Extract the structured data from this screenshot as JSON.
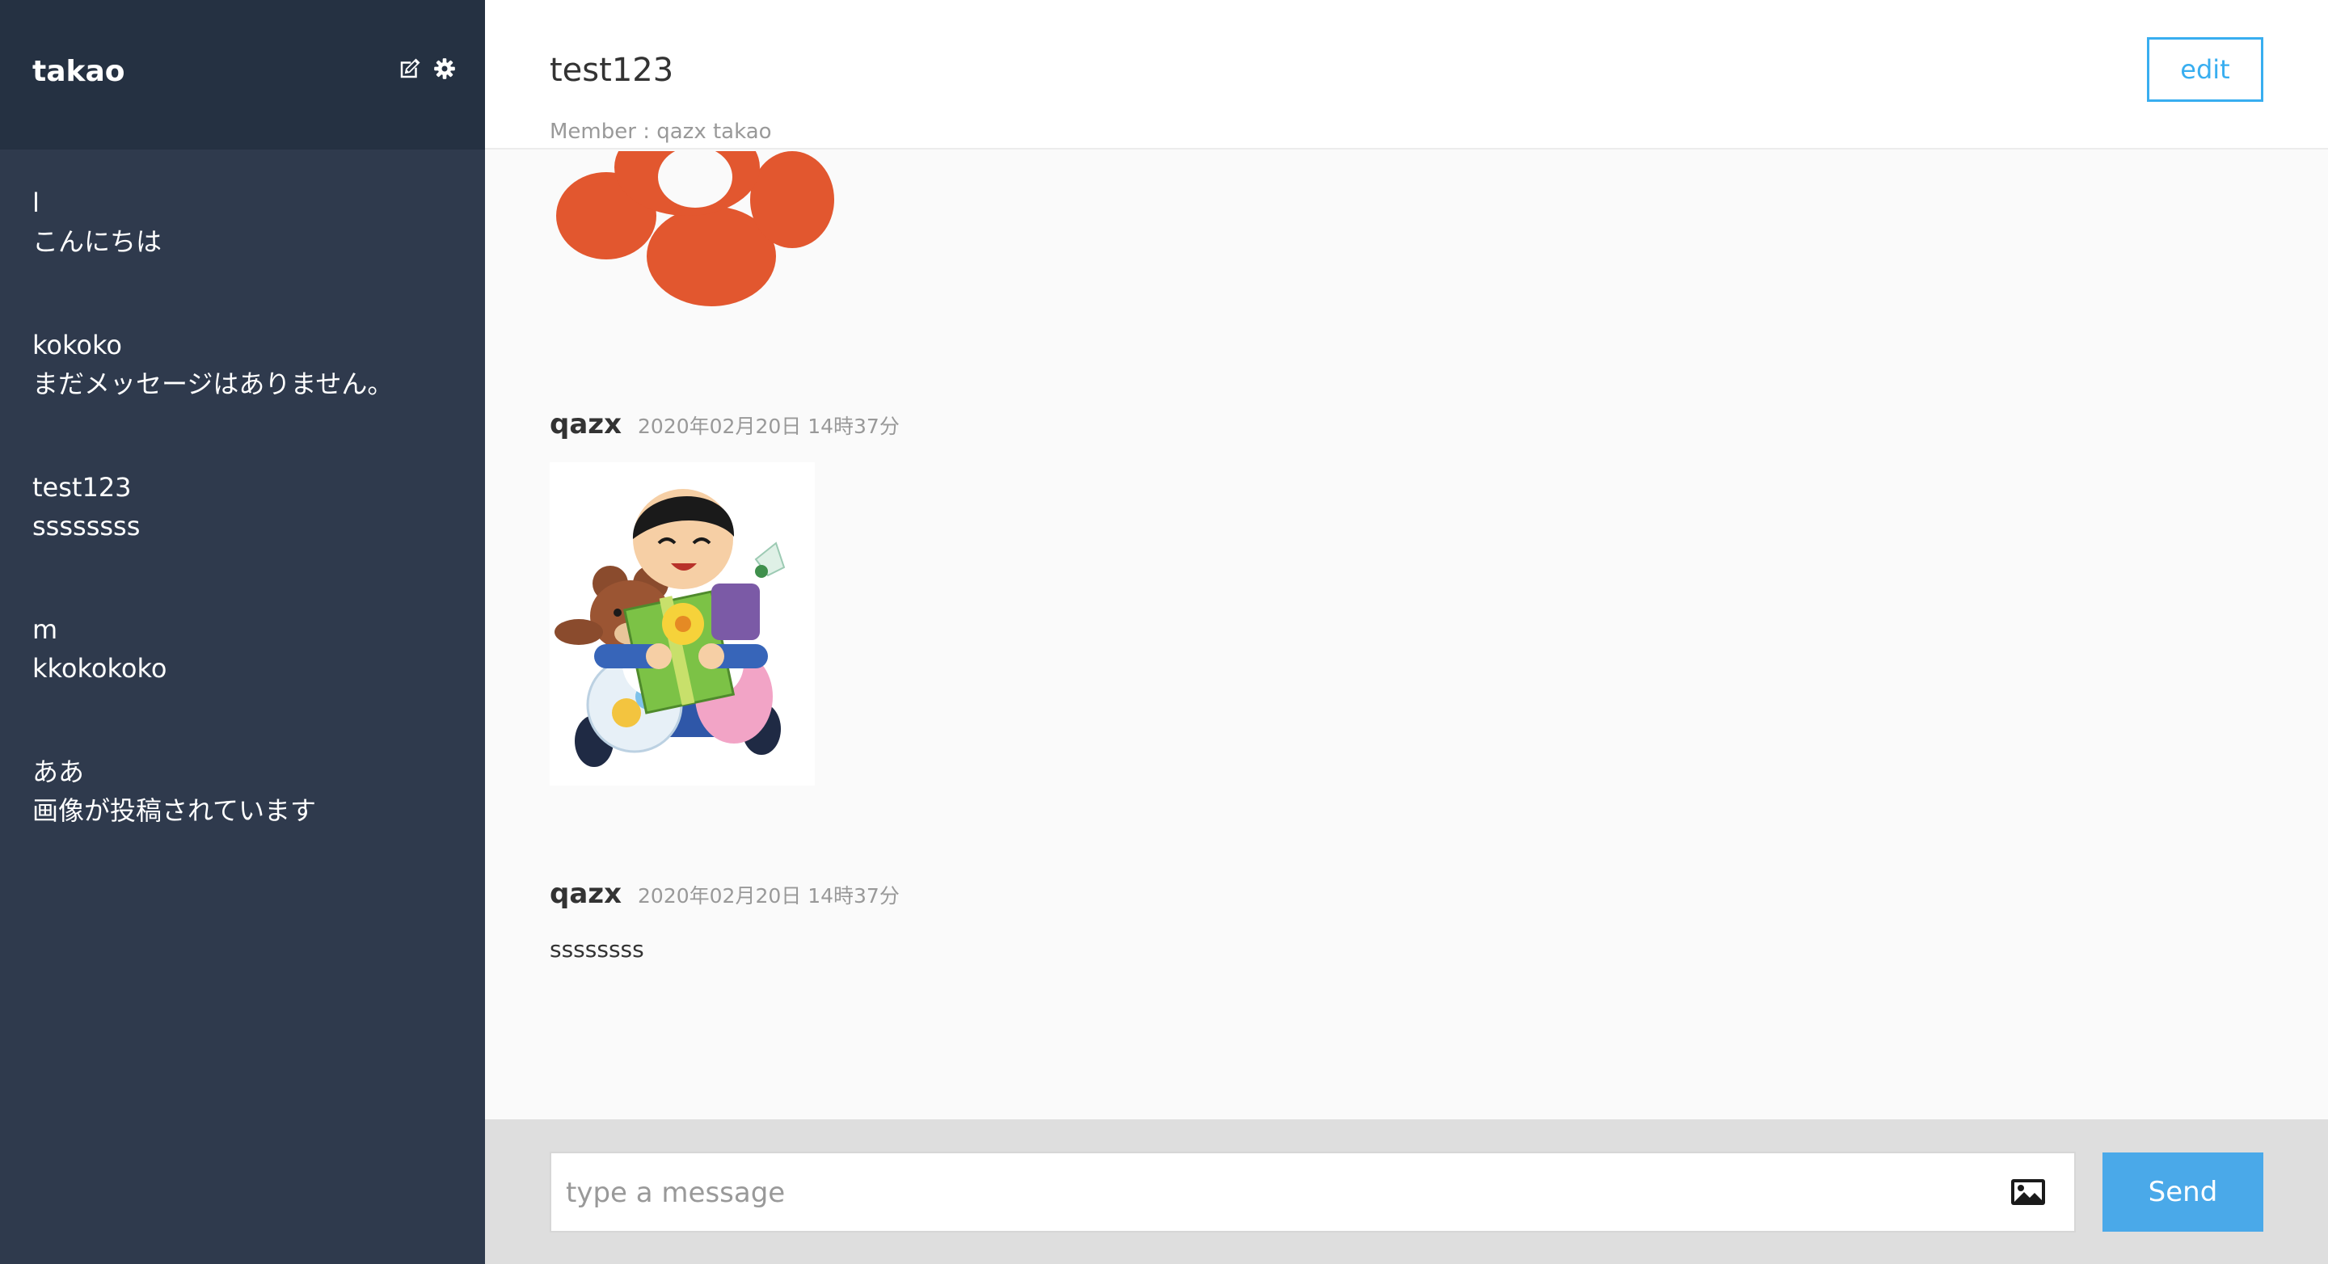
{
  "sidebar": {
    "user_name": "takao",
    "header_icons": [
      "edit-icon",
      "gear-icon"
    ],
    "groups": [
      {
        "name": "l",
        "last_message": "こんにちは"
      },
      {
        "name": "kokoko",
        "last_message": "まだメッセージはありません。"
      },
      {
        "name": "test123",
        "last_message": "ssssssss"
      },
      {
        "name": "m",
        "last_message": "kkokokoko"
      },
      {
        "name": "ああ",
        "last_message": "画像が投稿されています"
      }
    ]
  },
  "main": {
    "group_title": "test123",
    "members_label": "Member : qazx takao",
    "edit_label": "edit",
    "messages": [
      {
        "user": "qazx",
        "date": "2020年02月20日 14時37分",
        "image": "boy-with-presents-illustration"
      },
      {
        "user": "qazx",
        "date": "2020年02月20日 14時37分",
        "text": "ssssssss"
      }
    ],
    "partial_image": "red-flower-illustration"
  },
  "form": {
    "placeholder": "type a message",
    "image_icon": "image-icon",
    "send_label": "Send"
  },
  "colors": {
    "sidebar_bg": "#2f3a4d",
    "sidebar_header_bg": "#253142",
    "accent": "#38aef0",
    "send_button": "#4aa9e9"
  }
}
